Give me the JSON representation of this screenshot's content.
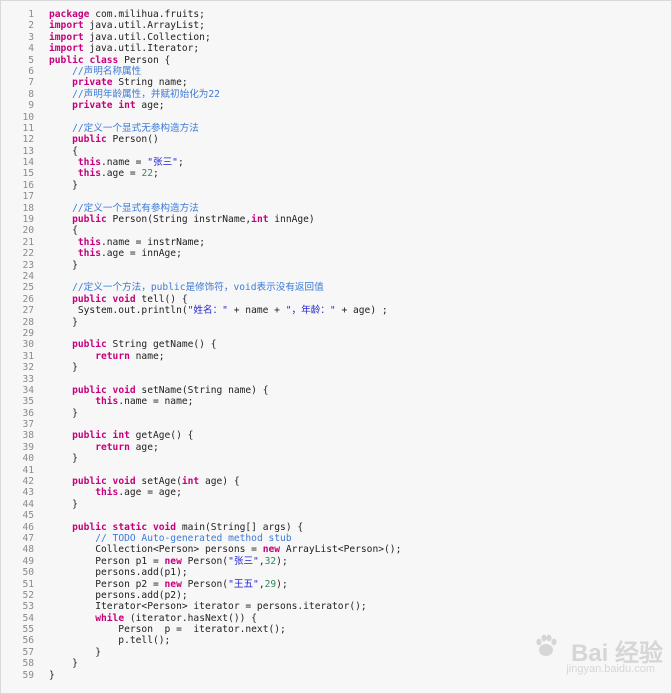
{
  "code_lines": [
    "package com.milihua.fruits;",
    "import java.util.ArrayList;",
    "import java.util.Collection;",
    "import java.util.Iterator;",
    "public class Person {",
    "    //声明名称属性",
    "    private String name;",
    "    //声明年龄属性，并赋初始化为22",
    "    private int age;",
    "",
    "    //定义一个显式无参构造方法",
    "    public Person()",
    "    {",
    "     this.name = \"张三\";",
    "     this.age = 22;",
    "    }",
    "",
    "    //定义一个显式有参构造方法",
    "    public Person(String instrName,int innAge)",
    "    {",
    "     this.name = instrName;",
    "     this.age = innAge;",
    "    }",
    "",
    "    //定义一个方法，public是修饰符，void表示没有返回值",
    "    public void tell() {",
    "     System.out.println(\"姓名：\" + name + \"，年龄：\" + age) ;",
    "    }",
    "",
    "    public String getName() {",
    "        return name;",
    "    }",
    "",
    "    public void setName(String name) {",
    "        this.name = name;",
    "    }",
    "",
    "    public int getAge() {",
    "        return age;",
    "    }",
    "",
    "    public void setAge(int age) {",
    "        this.age = age;",
    "    }",
    "",
    "    public static void main(String[] args) {",
    "        // TODO Auto-generated method stub",
    "        Collection<Person> persons = new ArrayList<Person>();",
    "        Person p1 = new Person(\"张三\",32);",
    "        persons.add(p1);",
    "        Person p2 = new Person(\"王五\",29);",
    "        persons.add(p2);",
    "        Iterator<Person> iterator = persons.iterator();",
    "        while (iterator.hasNext()) {",
    "            Person  p =  iterator.next();",
    "            p.tell();",
    "        }",
    "    }",
    "}"
  ],
  "watermark": {
    "brand": "Bai 经验",
    "url": "jingyan.baidu.com"
  },
  "colors": {
    "keyword": "#c6007c",
    "comment": "#3b7bd8",
    "string": "#2323d6",
    "number": "#2e8b57",
    "line_number": "#8a8a8a",
    "background": "#f7f7f7"
  }
}
